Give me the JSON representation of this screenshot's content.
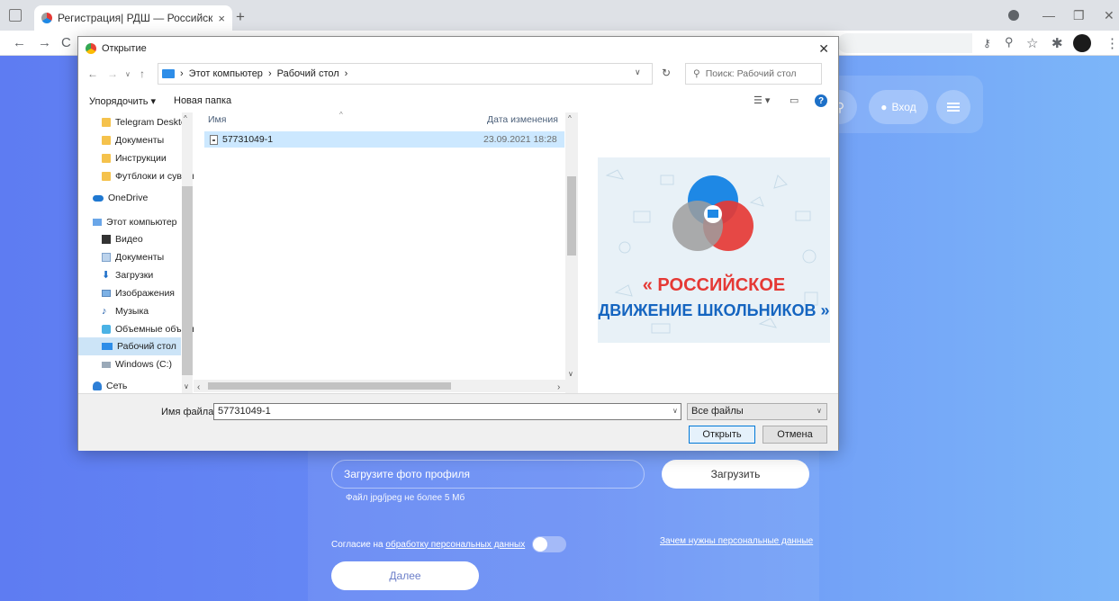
{
  "browser": {
    "tab_title": "Регистрация| РДШ — Российск",
    "tab_close": "×",
    "new_tab": "+",
    "win_minimize": "—",
    "win_restore": "❐",
    "win_close": "✕",
    "back": "←",
    "forward": "→",
    "reload": "C"
  },
  "page": {
    "login_label": "Вход",
    "photo_placeholder": "Загрузите фото профиля",
    "upload_label": "Загрузить",
    "file_hint": "Файл jpg/jpeg не более 5 Мб",
    "consent_prefix": "Согласие на ",
    "consent_link": "обработку персональных данных",
    "why_link": "Зачем нужны персональные данные",
    "next_label": "Далее"
  },
  "dialog": {
    "title": "Открытие",
    "close": "✕",
    "path": [
      "Этот компьютер",
      "Рабочий стол"
    ],
    "search_placeholder": "Поиск: Рабочий стол",
    "organize": "Упорядочить ▾",
    "new_folder": "Новая папка",
    "help": "?",
    "nav_items": [
      {
        "label": "Telegram Desktop",
        "icon": "folder-icon"
      },
      {
        "label": "Документы",
        "icon": "folder-icon"
      },
      {
        "label": "Инструкции",
        "icon": "folder-icon"
      },
      {
        "label": "Футблоки и сувенирка",
        "icon": "folder-icon"
      },
      {
        "label": "OneDrive",
        "icon": "cloud-icon"
      },
      {
        "label": "Этот компьютер",
        "icon": "computer-icon"
      },
      {
        "label": "Видео",
        "icon": "video-icon"
      },
      {
        "label": "Документы",
        "icon": "documents-icon"
      },
      {
        "label": "Загрузки",
        "icon": "download-icon"
      },
      {
        "label": "Изображения",
        "icon": "images-icon"
      },
      {
        "label": "Музыка",
        "icon": "music-icon"
      },
      {
        "label": "Объемные объекты",
        "icon": "3d-objects-icon"
      },
      {
        "label": "Рабочий стол",
        "icon": "desktop-icon"
      },
      {
        "label": "Windows (C:)",
        "icon": "drive-icon"
      },
      {
        "label": "Сеть",
        "icon": "network-icon"
      }
    ],
    "columns": {
      "name": "Имя",
      "date": "Дата изменения"
    },
    "files": [
      {
        "name": "57731049-1",
        "date": "23.09.2021 18:28"
      }
    ],
    "preview_text": {
      "line1": "« РОССИЙСКОЕ",
      "line2": "ДВИЖЕНИЕ ШКОЛЬНИКОВ »"
    },
    "filename_label": "Имя файла:",
    "filename_value": "57731049-1",
    "filetype": "Все файлы",
    "open_label": "Открыть",
    "cancel_label": "Отмена"
  },
  "colors": {
    "page_gradient_start": "#5e7cf2",
    "page_gradient_end": "#7cb6f9",
    "logo_blue": "#1e88e5",
    "logo_red": "#e53935",
    "logo_gray": "#9e9e9e",
    "logo_text_red": "#e53935",
    "logo_text_blue": "#1565c0"
  }
}
